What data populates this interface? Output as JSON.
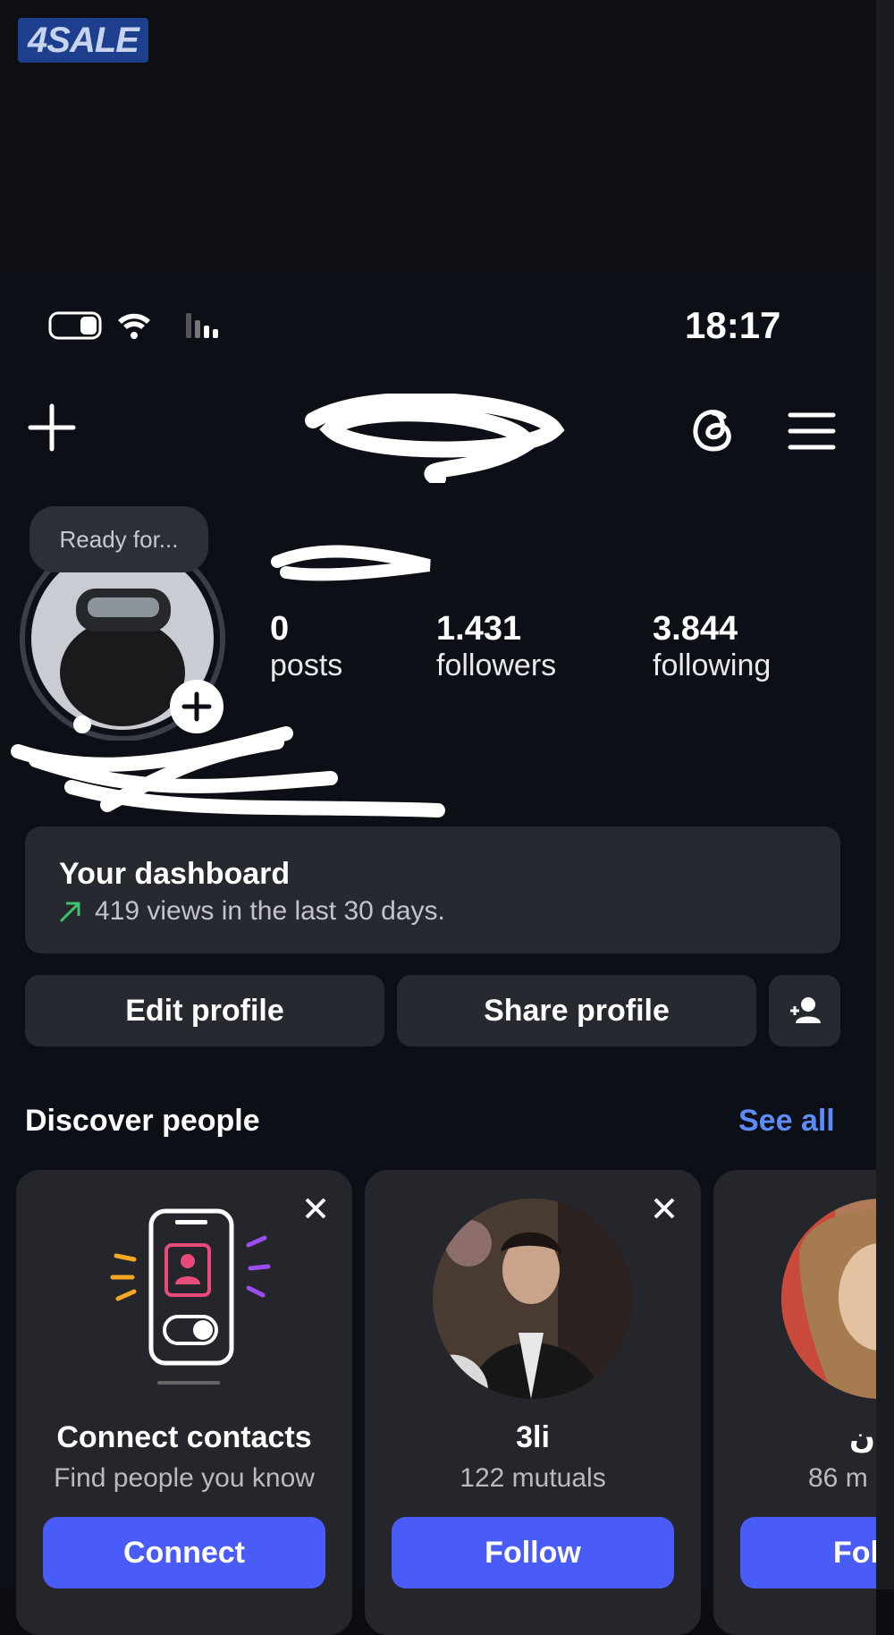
{
  "watermark": {
    "text": "4SALE"
  },
  "status_bar": {
    "time": "18:17"
  },
  "header": {
    "new_icon": "plus-icon",
    "threads_icon": "threads-icon",
    "menu_icon": "hamburger-menu-icon"
  },
  "profile": {
    "note_bubble": "Ready for...",
    "stats": [
      {
        "value": "0",
        "label": "posts"
      },
      {
        "value": "1.431",
        "label": "followers"
      },
      {
        "value": "3.844",
        "label": "following"
      }
    ]
  },
  "dashboard": {
    "title": "Your dashboard",
    "subtitle": "419 views in the last 30 days."
  },
  "actions": {
    "edit": "Edit profile",
    "share": "Share profile"
  },
  "discover": {
    "heading": "Discover people",
    "see_all": "See all",
    "cards": [
      {
        "title": "Connect contacts",
        "subtitle": "Find people you know",
        "button": "Connect"
      },
      {
        "title": "3li",
        "subtitle": "122 mutuals",
        "button": "Follow"
      },
      {
        "title": "ن",
        "subtitle": "86 m",
        "button": "Fol"
      }
    ]
  },
  "colors": {
    "background": "#0c0f16",
    "surface": "#262930",
    "accent_button": "#4a5cf7",
    "link": "#5b8cf7",
    "trend_up": "#3cc46b"
  }
}
